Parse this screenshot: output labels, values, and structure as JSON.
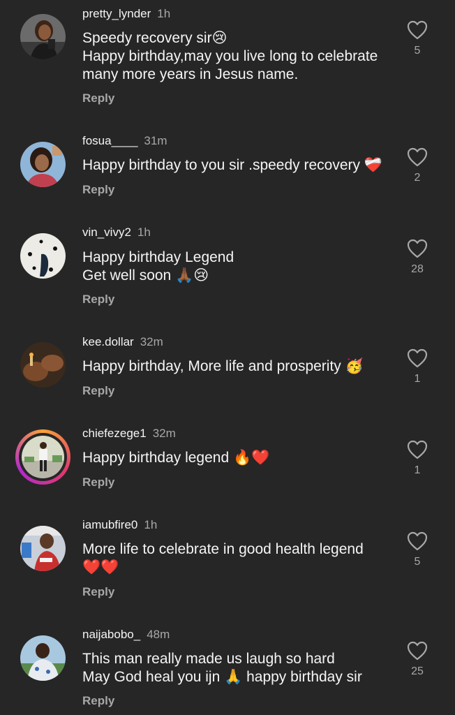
{
  "comments": [
    {
      "username": "pretty_lynder",
      "time": "1h",
      "text": "Speedy recovery sir😢\nHappy birthday,may you live long to celebrate many more years in Jesus name.",
      "reply": "Reply",
      "likes": "5"
    },
    {
      "username": "fosua____",
      "time": "31m",
      "text": "Happy birthday to you sir .speedy recovery ❤️‍🩹",
      "reply": "Reply",
      "likes": "2"
    },
    {
      "username": "vin_vivy2",
      "time": "1h",
      "text": "Happy birthday Legend\nGet well soon 🙏🏾😢",
      "reply": "Reply",
      "likes": "28"
    },
    {
      "username": "kee.dollar",
      "time": "32m",
      "text": "Happy birthday, More life and prosperity 🥳",
      "reply": "Reply",
      "likes": "1"
    },
    {
      "username": "chiefezege1",
      "time": "32m",
      "text": "Happy birthday legend 🔥❤️",
      "reply": "Reply",
      "likes": "1"
    },
    {
      "username": "iamubfire0",
      "time": "1h",
      "text": "More life to celebrate in good health legend\n❤️❤️",
      "reply": "Reply",
      "likes": "5"
    },
    {
      "username": "naijabobo_",
      "time": "48m",
      "text": "This man really made us laugh so hard\nMay God heal you ijn 🙏 happy birthday sir",
      "reply": "Reply",
      "likes": "25"
    }
  ],
  "icons": {
    "like": "heart-outline-icon"
  },
  "colors": {
    "background": "#262626",
    "primary_text": "#f5f5f5",
    "secondary_text": "#a8a8a8"
  }
}
